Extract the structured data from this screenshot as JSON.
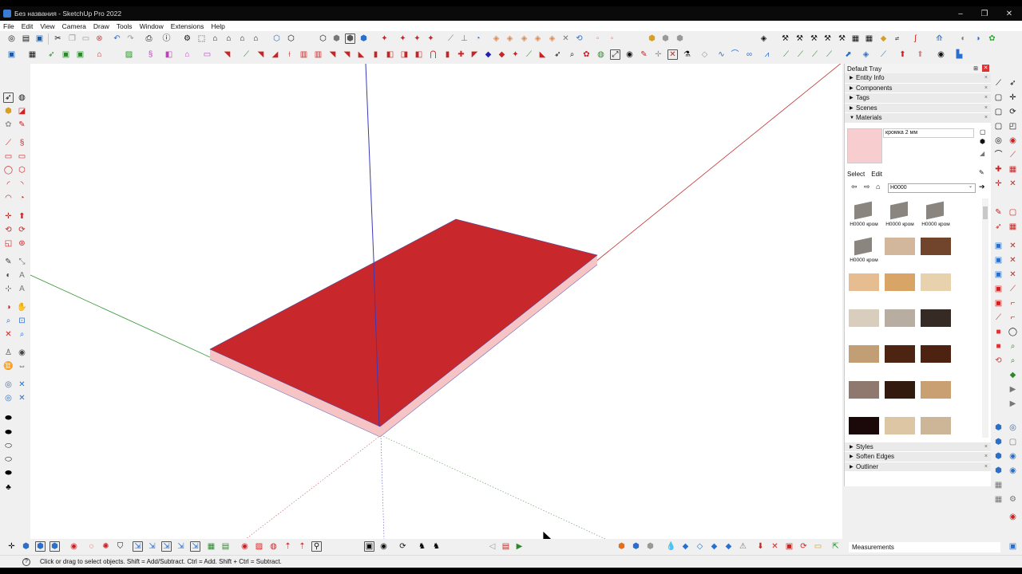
{
  "window": {
    "title": "Без названия - SketchUp Pro 2022",
    "minimize": "–",
    "maximize": "❐",
    "close": "✕"
  },
  "menu": [
    "File",
    "Edit",
    "View",
    "Camera",
    "Draw",
    "Tools",
    "Window",
    "Extensions",
    "Help"
  ],
  "tray": {
    "title": "Default Tray",
    "sections_top": [
      "Entity Info",
      "Components",
      "Tags",
      "Scenes"
    ],
    "materials_title": "Materials",
    "sections_bottom": [
      "Styles",
      "Soften Edges",
      "Outliner"
    ],
    "material_name": "кромка 2 мм",
    "tab_select": "Select",
    "tab_edit": "Edit",
    "library": "H0000",
    "swatch_labels": [
      "H0000 кром",
      "H0000 кром",
      "H0000 кром",
      "H0000 кром"
    ],
    "swatch_colors": [
      "#d3b79c",
      "#70452b",
      "#e6bd91",
      "#d9a566",
      "#e8d2ad",
      "#d9cebd",
      "#b7ada1",
      "#352a24",
      "#c29e74",
      "#4d2312",
      "#4e2210",
      "#8f796e",
      "#331a0e",
      "#c8a072",
      "#1a0908",
      "#ddc6a3",
      "#cdb698"
    ],
    "preview_color": "#f8cdcf"
  },
  "model": {
    "face_color": "#c8282c",
    "edge_color": "#f6c4c4"
  },
  "measurements_label": "Measurements",
  "status_text": "Click or drag to select objects. Shift = Add/Subtract. Ctrl = Add. Shift + Ctrl = Subtract."
}
